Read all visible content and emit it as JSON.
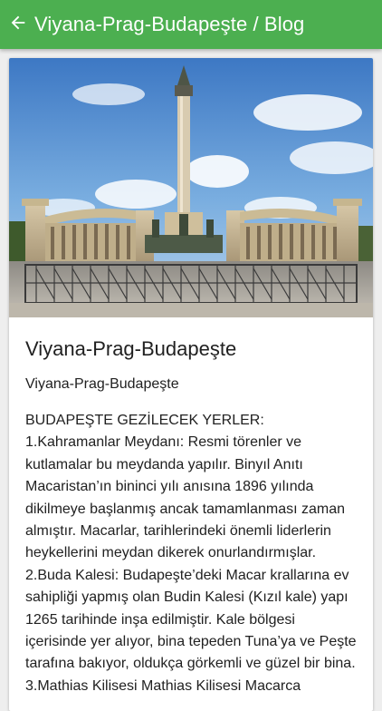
{
  "app_bar": {
    "title": "Viyana-Prag-Budapeşte / Blog",
    "back_icon": "arrow-left-icon",
    "color": "#4caf50"
  },
  "post": {
    "image": "heroes-square-monument-photo",
    "title": "Viyana-Prag-Budapeşte",
    "subtitle": "Viyana-Prag-Budapeşte",
    "content": "BUDAPEŞTE GEZİLECEK YERLER:   1.Kahramanlar Meydanı: Resmi törenler ve kutlamalar bu meydanda yapılır. Binyıl Anıtı Macaristan’ın bininci yılı anısına 1896 yılında dikilmeye başlanmış ancak tamamlanması zaman almıştır. Macarlar, tarihlerindeki önemli liderlerin heykellerini meydan dikerek onurlandırmışlar.   2.Buda Kalesi: Budapeşte’deki Macar krallarına ev sahipliği yapmış olan Budin Kalesi (Kızıl kale) yapı 1265 tarihinde inşa edilmiştir. Kale bölgesi içerisinde yer alıyor, bina tepeden Tuna’ya ve Peşte tarafına bakıyor, oldukça görkemli ve güzel bir bina.   3.Mathias Kilisesi Mathias Kilisesi Macarca"
  }
}
